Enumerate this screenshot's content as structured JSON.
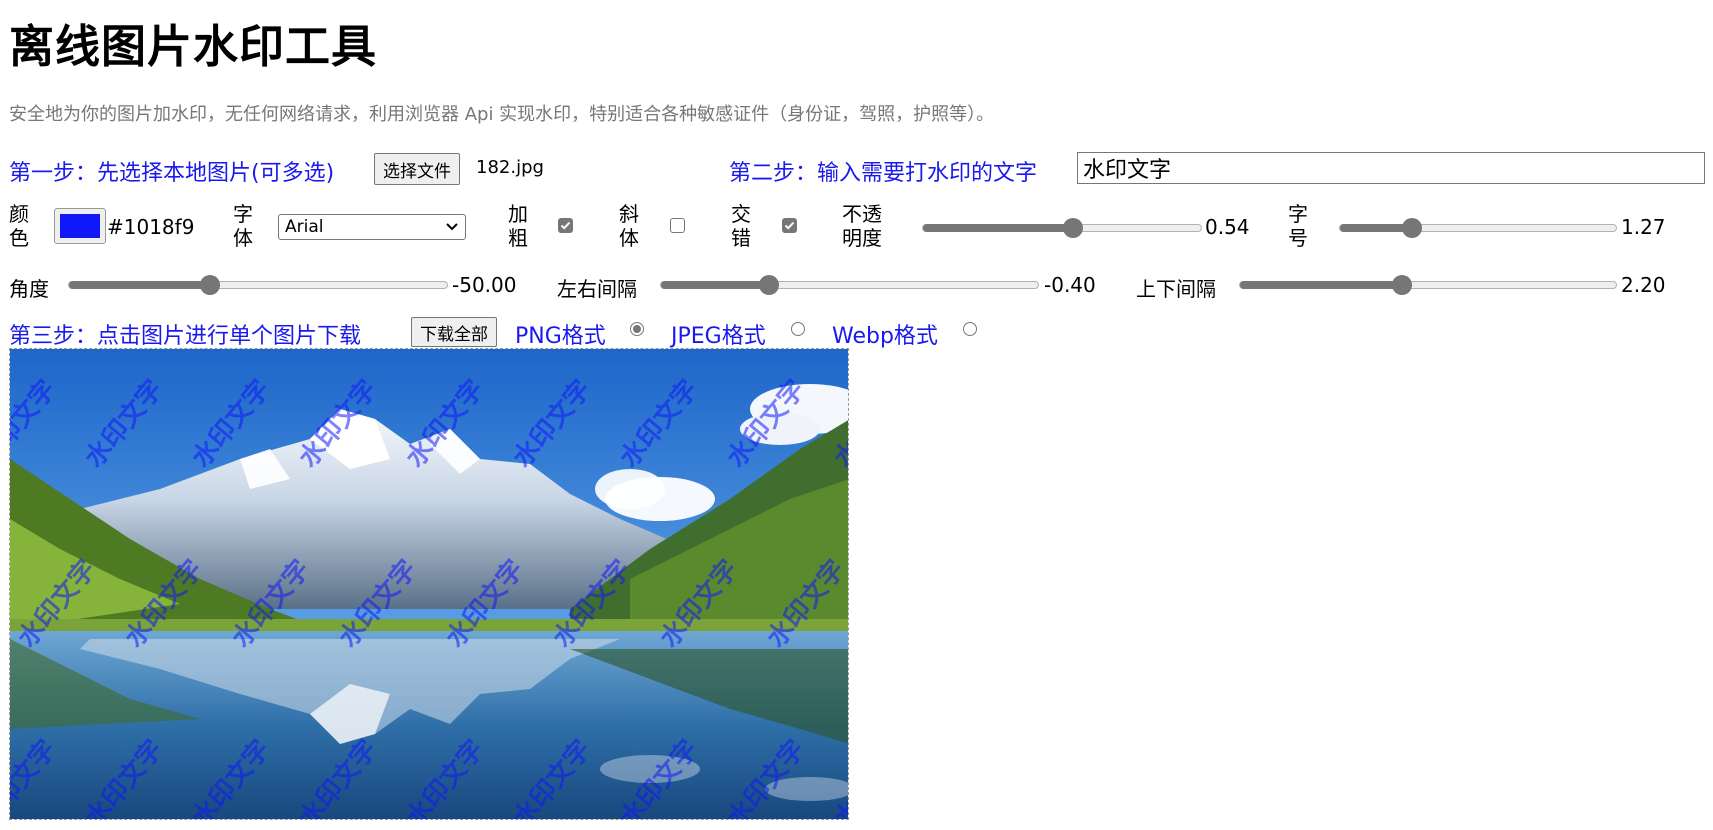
{
  "title": "离线图片水印工具",
  "description": "安全地为你的图片加水印，无任何网络请求，利用浏览器 Api 实现水印，特别适合各种敏感证件（身份证，驾照，护照等）。",
  "step1": {
    "label": "第一步：先选择本地图片(可多选)",
    "button": "选择文件",
    "filename": "182.jpg"
  },
  "step2": {
    "label": "第二步：输入需要打水印的文字",
    "value": "水印文字"
  },
  "options": {
    "color_label": "颜色",
    "color_value": "#1018f9",
    "font_label": "字体",
    "font_value": "Arial",
    "bold_label": "加粗",
    "bold_checked": true,
    "italic_label": "斜体",
    "italic_checked": false,
    "stagger_label": "交错",
    "stagger_checked": true,
    "opacity_label": "不透明度",
    "opacity_value": "0.54",
    "fontsize_label": "字号",
    "fontsize_value": "1.27",
    "angle_label": "角度",
    "angle_value": "-50.00",
    "hspacing_label": "左右间隔",
    "hspacing_value": "-0.40",
    "vspacing_label": "上下间隔",
    "vspacing_value": "2.20"
  },
  "step3": {
    "label": "第三步：点击图片进行单个图片下载",
    "button": "下载全部",
    "formats": [
      {
        "label": "PNG格式",
        "selected": true
      },
      {
        "label": "JPEG格式",
        "selected": false
      },
      {
        "label": "Webp格式",
        "selected": false
      }
    ]
  },
  "watermark_text": "水印文字",
  "colors": {
    "accent": "#1a1aee",
    "watermark": "#1018f9"
  }
}
